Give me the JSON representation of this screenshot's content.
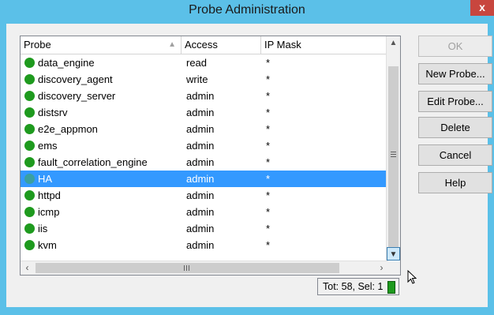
{
  "window": {
    "title": "Probe Administration",
    "close_glyph": "x"
  },
  "columns": {
    "probe": "Probe",
    "access": "Access",
    "ip_mask": "IP Mask"
  },
  "rows": [
    {
      "probe": "data_engine",
      "access": "read",
      "mask": "*"
    },
    {
      "probe": "discovery_agent",
      "access": "write",
      "mask": "*"
    },
    {
      "probe": "discovery_server",
      "access": "admin",
      "mask": "*"
    },
    {
      "probe": "distsrv",
      "access": "admin",
      "mask": "*"
    },
    {
      "probe": "e2e_appmon",
      "access": "admin",
      "mask": "*"
    },
    {
      "probe": "ems",
      "access": "admin",
      "mask": "*"
    },
    {
      "probe": "fault_correlation_engine",
      "access": "admin",
      "mask": "*"
    },
    {
      "probe": "HA",
      "access": "admin",
      "mask": "*",
      "selected": true
    },
    {
      "probe": "httpd",
      "access": "admin",
      "mask": "*"
    },
    {
      "probe": "icmp",
      "access": "admin",
      "mask": "*"
    },
    {
      "probe": "iis",
      "access": "admin",
      "mask": "*"
    },
    {
      "probe": "kvm",
      "access": "admin",
      "mask": "*"
    }
  ],
  "status": {
    "text": "Tot: 58,  Sel: 1"
  },
  "buttons": {
    "ok": "OK",
    "new_probe": "New Probe...",
    "edit_probe": "Edit Probe...",
    "delete": "Delete",
    "cancel": "Cancel",
    "help": "Help"
  },
  "colors": {
    "title_bar": "#5bc0e8",
    "selection": "#3399ff",
    "status_ok": "#1e9a1e"
  }
}
